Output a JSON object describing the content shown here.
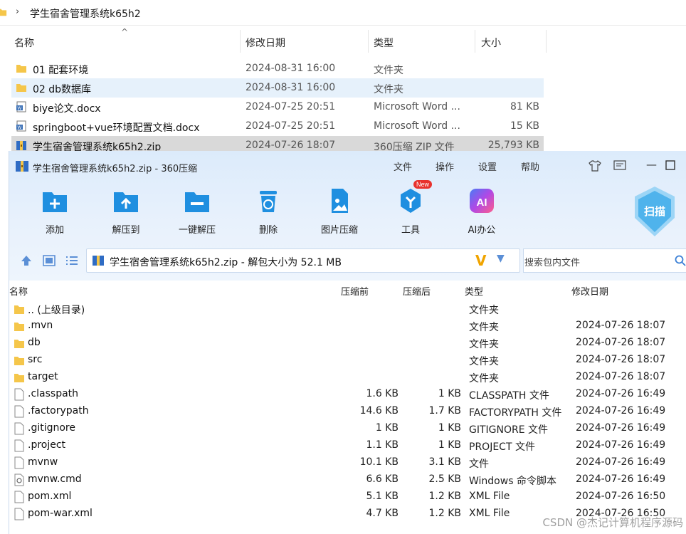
{
  "explorer": {
    "breadcrumb": "学生宿舍管理系统k65h2",
    "columns": {
      "name": "名称",
      "date": "修改日期",
      "type": "类型",
      "size": "大小"
    },
    "rows": [
      {
        "name": "01 配套环境",
        "date": "2024-08-31 16:00",
        "type": "文件夹",
        "size": "",
        "icon": "folder-icon"
      },
      {
        "name": "02 db数据库",
        "date": "2024-08-31 16:00",
        "type": "文件夹",
        "size": "",
        "icon": "folder-icon"
      },
      {
        "name": "biye论文.docx",
        "date": "2024-07-25 20:51",
        "type": "Microsoft Word ...",
        "size": "81 KB",
        "icon": "word-doc-icon"
      },
      {
        "name": "springboot+vue环境配置文档.docx",
        "date": "2024-07-25 20:51",
        "type": "Microsoft Word ...",
        "size": "15 KB",
        "icon": "word-doc-icon"
      },
      {
        "name": "学生宿舍管理系统k65h2.zip",
        "date": "2024-07-26 18:07",
        "type": "360压缩 ZIP 文件",
        "size": "25,793 KB",
        "icon": "zip-archive-icon"
      }
    ]
  },
  "zip": {
    "title": "学生宿舍管理系统k65h2.zip - 360压缩",
    "menu": [
      "文件",
      "操作",
      "设置",
      "帮助"
    ],
    "toolbar": [
      {
        "label": "添加",
        "icon": "add-icon"
      },
      {
        "label": "解压到",
        "icon": "extract-to-icon"
      },
      {
        "label": "一键解压",
        "icon": "one-click-extract-icon"
      },
      {
        "label": "删除",
        "icon": "delete-icon"
      },
      {
        "label": "图片压缩",
        "icon": "image-compress-icon"
      },
      {
        "label": "工具",
        "icon": "tools-icon",
        "badge": "New"
      },
      {
        "label": "AI办公",
        "icon": "ai-office-icon",
        "icon_text": "AI"
      }
    ],
    "scan_label": "扫描",
    "path_text": "学生宿舍管理系统k65h2.zip - 解包大小为 52.1 MB",
    "search_placeholder": "搜索包内文件",
    "columns": {
      "name": "名称",
      "before": "压缩前",
      "after": "压缩后",
      "type": "类型",
      "date": "修改日期"
    },
    "rows": [
      {
        "name": ".. (上级目录)",
        "before": "",
        "after": "",
        "type": "文件夹",
        "date": "",
        "icon": "folder-icon"
      },
      {
        "name": ".mvn",
        "before": "",
        "after": "",
        "type": "文件夹",
        "date": "2024-07-26 18:07",
        "icon": "folder-icon"
      },
      {
        "name": "db",
        "before": "",
        "after": "",
        "type": "文件夹",
        "date": "2024-07-26 18:07",
        "icon": "folder-icon"
      },
      {
        "name": "src",
        "before": "",
        "after": "",
        "type": "文件夹",
        "date": "2024-07-26 18:07",
        "icon": "folder-icon"
      },
      {
        "name": "target",
        "before": "",
        "after": "",
        "type": "文件夹",
        "date": "2024-07-26 18:07",
        "icon": "folder-icon"
      },
      {
        "name": ".classpath",
        "before": "1.6 KB",
        "after": "1 KB",
        "type": "CLASSPATH 文件",
        "date": "2024-07-26 16:49",
        "icon": "file-icon"
      },
      {
        "name": ".factorypath",
        "before": "14.6 KB",
        "after": "1.7 KB",
        "type": "FACTORYPATH 文件",
        "date": "2024-07-26 16:49",
        "icon": "file-icon"
      },
      {
        "name": ".gitignore",
        "before": "1 KB",
        "after": "1 KB",
        "type": "GITIGNORE 文件",
        "date": "2024-07-26 16:49",
        "icon": "file-icon"
      },
      {
        "name": ".project",
        "before": "1.1 KB",
        "after": "1 KB",
        "type": "PROJECT 文件",
        "date": "2024-07-26 16:49",
        "icon": "file-icon"
      },
      {
        "name": "mvnw",
        "before": "10.1 KB",
        "after": "3.1 KB",
        "type": "文件",
        "date": "2024-07-26 16:49",
        "icon": "file-icon"
      },
      {
        "name": "mvnw.cmd",
        "before": "6.6 KB",
        "after": "2.5 KB",
        "type": "Windows 命令脚本",
        "date": "2024-07-26 16:49",
        "icon": "cmd-script-icon"
      },
      {
        "name": "pom.xml",
        "before": "5.1 KB",
        "after": "1.2 KB",
        "type": "XML File",
        "date": "2024-07-26 16:50",
        "icon": "file-icon"
      },
      {
        "name": "pom-war.xml",
        "before": "4.7 KB",
        "after": "1.2 KB",
        "type": "XML File",
        "date": "2024-07-26 16:50",
        "icon": "file-icon"
      }
    ]
  },
  "watermark": "CSDN @杰记计算机程序源码",
  "colors": {
    "accent": "#1f8fe0",
    "folder": "#f5c64a",
    "new_badge": "#e8322e",
    "v_mark": "#f0a400"
  }
}
